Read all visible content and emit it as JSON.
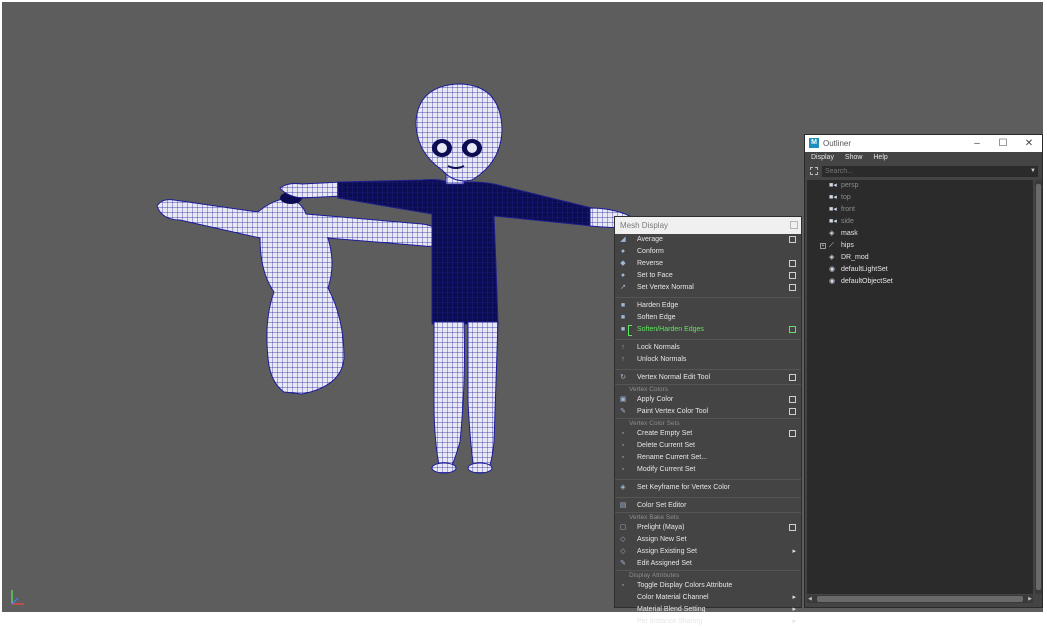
{
  "mesh_menu": {
    "title": "Mesh Display",
    "items": [
      {
        "kind": "item",
        "label": "Average",
        "icon": "average-normals-icon",
        "option": true
      },
      {
        "kind": "item",
        "label": "Conform",
        "icon": "conform-normals-icon",
        "option": false
      },
      {
        "kind": "item",
        "label": "Reverse",
        "icon": "reverse-normals-icon",
        "option": true
      },
      {
        "kind": "item",
        "label": "Set to Face",
        "icon": "set-to-face-icon",
        "option": true
      },
      {
        "kind": "item",
        "label": "Set Vertex Normal",
        "icon": "set-vertex-normal-icon",
        "option": true
      },
      {
        "kind": "sep"
      },
      {
        "kind": "item",
        "label": "Harden Edge",
        "icon": "harden-edge-icon",
        "option": false
      },
      {
        "kind": "item",
        "label": "Soften Edge",
        "icon": "soften-edge-icon",
        "option": false
      },
      {
        "kind": "item",
        "label": "Soften/Harden Edges",
        "icon": "soften-harden-edges-icon",
        "option": true,
        "highlight": true
      },
      {
        "kind": "sep"
      },
      {
        "kind": "item",
        "label": "Lock Normals",
        "icon": "lock-normals-icon",
        "option": false
      },
      {
        "kind": "item",
        "label": "Unlock Normals",
        "icon": "unlock-normals-icon",
        "option": false
      },
      {
        "kind": "sep"
      },
      {
        "kind": "item",
        "label": "Vertex Normal Edit Tool",
        "icon": "vertex-normal-edit-icon",
        "option": true
      },
      {
        "kind": "section",
        "label": "Vertex Colors"
      },
      {
        "kind": "item",
        "label": "Apply Color",
        "icon": "apply-color-icon",
        "option": true
      },
      {
        "kind": "item",
        "label": "Paint Vertex Color Tool",
        "icon": "paint-brush-icon",
        "option": true
      },
      {
        "kind": "section",
        "label": "Vertex Color Sets"
      },
      {
        "kind": "item",
        "label": "Create Empty Set",
        "icon": "create-set-icon",
        "option": true
      },
      {
        "kind": "item",
        "label": "Delete Current Set",
        "icon": "delete-set-icon",
        "option": false
      },
      {
        "kind": "item",
        "label": "Rename Current Set...",
        "icon": "rename-set-icon",
        "option": false
      },
      {
        "kind": "item",
        "label": "Modify Current Set",
        "icon": "modify-set-icon",
        "option": false
      },
      {
        "kind": "sep"
      },
      {
        "kind": "item",
        "label": "Set Keyframe for Vertex Color",
        "icon": "keyframe-icon",
        "option": false
      },
      {
        "kind": "sep"
      },
      {
        "kind": "item",
        "label": "Color Set Editor",
        "icon": "color-set-editor-icon",
        "option": false
      },
      {
        "kind": "section",
        "label": "Vertex Bake Sets"
      },
      {
        "kind": "item",
        "label": "Prelight (Maya)",
        "icon": "prelight-icon",
        "option": true
      },
      {
        "kind": "item",
        "label": "Assign New Set",
        "icon": "assign-new-set-icon",
        "option": false
      },
      {
        "kind": "item",
        "label": "Assign Existing Set",
        "icon": "assign-existing-set-icon",
        "option": false,
        "submenu": true
      },
      {
        "kind": "item",
        "label": "Edit Assigned Set",
        "icon": "edit-assigned-set-icon",
        "option": false
      },
      {
        "kind": "section",
        "label": "Display Attributes"
      },
      {
        "kind": "item",
        "label": "Toggle Display Colors Attribute",
        "icon": "toggle-display-colors-icon",
        "option": false
      },
      {
        "kind": "item",
        "label": "Color Material Channel",
        "icon": "",
        "option": false,
        "submenu": true
      },
      {
        "kind": "item",
        "label": "Material Blend Setting",
        "icon": "",
        "option": false,
        "submenu": true
      },
      {
        "kind": "item",
        "label": "Per Instance Sharing",
        "icon": "",
        "option": false,
        "submenu": true
      }
    ]
  },
  "outliner": {
    "title": "Outliner",
    "menus": [
      "Display",
      "Show",
      "Help"
    ],
    "search_placeholder": "Search...",
    "items": [
      {
        "label": "persp",
        "icon": "camera-icon",
        "dim": true,
        "expand": false
      },
      {
        "label": "top",
        "icon": "camera-icon",
        "dim": true,
        "expand": false
      },
      {
        "label": "front",
        "icon": "camera-icon",
        "dim": true,
        "expand": false
      },
      {
        "label": "side",
        "icon": "camera-icon",
        "dim": true,
        "expand": false
      },
      {
        "label": "mask",
        "icon": "transform-node-icon",
        "dim": false,
        "expand": false
      },
      {
        "label": "hips",
        "icon": "joint-icon",
        "dim": false,
        "expand": true
      },
      {
        "label": "DR_mod",
        "icon": "transform-node-icon",
        "dim": false,
        "expand": false
      },
      {
        "label": "defaultLightSet",
        "icon": "set-icon",
        "dim": false,
        "expand": false
      },
      {
        "label": "defaultObjectSet",
        "icon": "set-icon",
        "dim": false,
        "expand": false
      }
    ]
  },
  "colors": {
    "viewport_bg": "#5d5d5d",
    "wire": "#1c1c9a",
    "mesh_white": "#e8e8f4",
    "highlight": "#5fe65f"
  }
}
